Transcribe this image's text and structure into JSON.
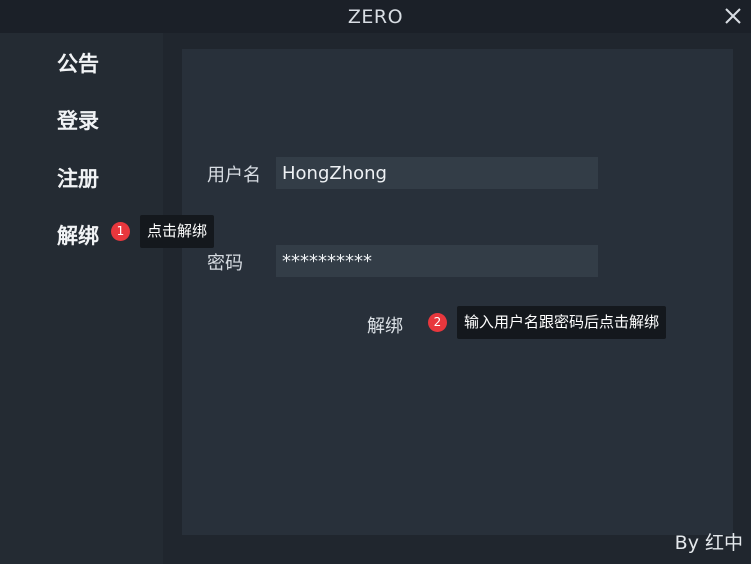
{
  "window": {
    "title": "ZERO"
  },
  "sidebar": {
    "items": [
      {
        "label": "公告"
      },
      {
        "label": "登录"
      },
      {
        "label": "注册"
      },
      {
        "label": "解绑"
      }
    ]
  },
  "form": {
    "username_label": "用户名",
    "username_value": "HongZhong",
    "password_label": "密码",
    "password_value": "**********",
    "submit_label": "解绑"
  },
  "annotations": [
    {
      "number": "1",
      "text": "点击解绑"
    },
    {
      "number": "2",
      "text": "输入用户名跟密码后点击解绑"
    }
  ],
  "footer": {
    "credit": "By 红中"
  },
  "colors": {
    "badge": "#e8373d",
    "tooltip_bg": "#14181d",
    "panel_bg": "#28303a",
    "input_bg": "#333d47"
  },
  "icons": {
    "close": "close-icon"
  }
}
